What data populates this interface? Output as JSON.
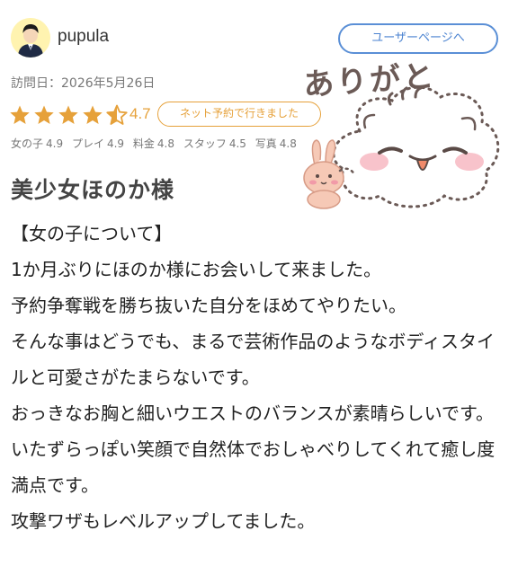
{
  "user": {
    "name": "pupula",
    "avatar_icon": "user-avatar-icon",
    "page_button": "ユーザーページへ"
  },
  "visit": {
    "date_text": "訪問日：2026年5月26日"
  },
  "rating": {
    "value": "4.7",
    "stars_filled": 4.5,
    "stars_total": 5,
    "badge": "ネット予約で行きました",
    "star_color": "#e6a13a"
  },
  "subscores": [
    {
      "label": "女の子",
      "value": "4.9"
    },
    {
      "label": "プレイ",
      "value": "4.9"
    },
    {
      "label": "料金",
      "value": "4.8"
    },
    {
      "label": "スタッフ",
      "value": "4.5"
    },
    {
      "label": "写真",
      "value": "4.8"
    }
  ],
  "review": {
    "title": "美少女ほのか様",
    "paragraphs": [
      "【女の子について】",
      "1か月ぶりにほのか様にお会いして来ました。",
      "予約争奪戦を勝ち抜いた自分をほめてやりたい。",
      "そんな事はどうでも、まるで芸術作品のようなボディスタイルと可愛さがたまらないです。",
      "おっきなお胸と細いウエストのバランスが素晴らしいです。",
      "いたずらっぽい笑顔で自然体でおしゃべりしてくれて癒し度満点です。",
      "攻撃ワザもレベルアップしてました。"
    ]
  },
  "sticker": {
    "caption": "ありがと",
    "icon": "thank-you-sticker-icon"
  }
}
